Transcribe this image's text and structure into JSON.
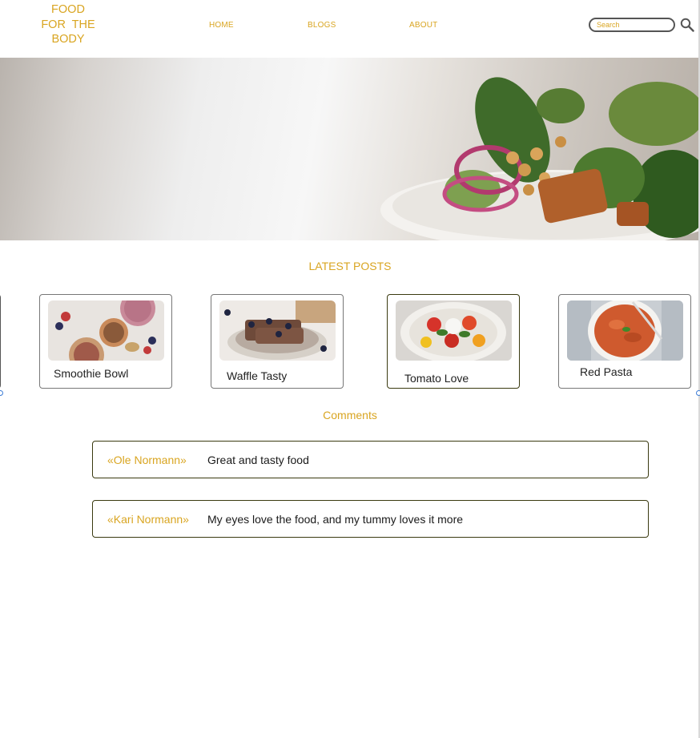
{
  "header": {
    "logo_lines": [
      "FOOD",
      "FOR THE",
      "BODY"
    ],
    "nav": [
      {
        "label": "HOME"
      },
      {
        "label": "BLOGS"
      },
      {
        "label": "ABOUT"
      }
    ],
    "search_placeholder": "Search",
    "search_icon": "magnifier-icon"
  },
  "hero": {
    "image": "salad-plate-photo"
  },
  "latest_posts": {
    "title": "LATEST POSTS",
    "posts": [
      {
        "title": "Smoothie Bowl",
        "image": "smoothie-bowl-photo"
      },
      {
        "title": "Waffle Tasty",
        "image": "waffles-photo"
      },
      {
        "title": "Tomato Love",
        "image": "tomato-salad-photo"
      },
      {
        "title": "Red Pasta",
        "image": "red-pasta-photo"
      }
    ]
  },
  "comments": {
    "title": "Comments",
    "items": [
      {
        "author": "«Ole Normann»",
        "text": "Great and tasty food"
      },
      {
        "author": "«Kari Normann»",
        "text": "My eyes love the food, and my tummy loves it more"
      }
    ]
  },
  "colors": {
    "accent": "#d9a521",
    "card_border": "#777777",
    "selected_border": "#3a3a10"
  }
}
